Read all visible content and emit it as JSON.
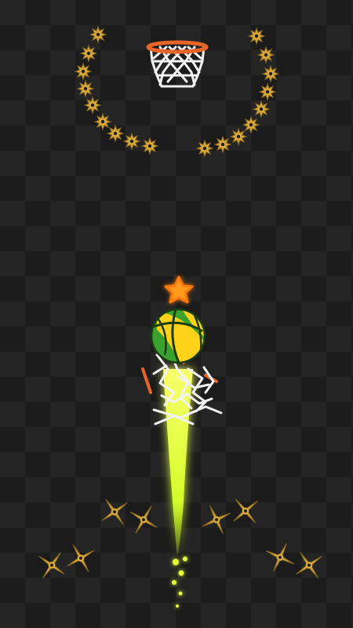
{
  "game": {
    "background": {
      "dark": "#1b1b1b",
      "light": "#262626"
    },
    "colors": {
      "star_gold": "#d9a93b",
      "star_gold_dark": "#8a6a1e",
      "hoop_rim": "#e8652a",
      "net": "#f2f2f2",
      "bonus_star": "#ff9a1f",
      "ball_green": "#3aa12e",
      "ball_yellow": "#ffd21a",
      "ball_seam": "#1a3a10",
      "trail": "#e6ff3a"
    },
    "icons": {
      "top_stars": "spiked-star-icon",
      "hoop": "basketball-hoop-icon",
      "bonus_star": "star-icon",
      "ball": "basketball-icon",
      "broken_hoop": "broken-hoop-icon",
      "ground_stars": "shuriken-icon"
    }
  }
}
